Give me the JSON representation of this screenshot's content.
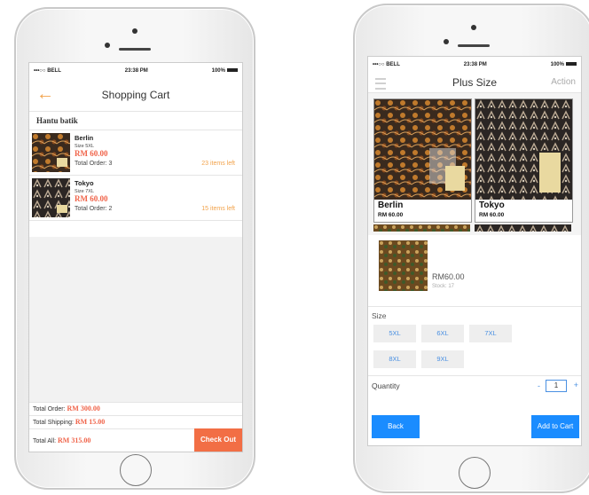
{
  "colors": {
    "accent_orange": "#f2a24a",
    "price_red": "#f0644a",
    "checkout_bg": "#f26e45",
    "primary_blue": "#1a8cff",
    "link_blue": "#4a90e2"
  },
  "status_bar": {
    "carrier": "•••○○ BELL",
    "time": "23:38 PM",
    "battery": "100%"
  },
  "cart_screen": {
    "title": "Shopping Cart",
    "back_icon": "arrow-left-icon",
    "shop_name": "Hantu batik",
    "items": [
      {
        "name": "Berlin",
        "size": "Size 5XL",
        "price": "RM 60.00",
        "total_order": "Total Order: 3",
        "items_left": "23 items left"
      },
      {
        "name": "Tokyo",
        "size": "Size 7XL",
        "price": "RM 60.00",
        "total_order": "Total Order: 2",
        "items_left": "15 items left"
      }
    ],
    "summary": {
      "total_order_label": "Total Order: ",
      "total_order_value": "RM 300.00",
      "total_shipping_label": "Total Shipping: ",
      "total_shipping_value": "RM 15.00",
      "total_all_label": "Total All: ",
      "total_all_value": "RM 315.00"
    },
    "checkout_label": "Check Out"
  },
  "product_screen": {
    "title": "Plus Size",
    "action_label": "Action",
    "menu_icon": "hamburger-menu-icon",
    "products": [
      {
        "name": "Berlin",
        "price": "RM 60.00"
      },
      {
        "name": "Tokyo",
        "price": "RM 60.00"
      }
    ],
    "detail": {
      "price": "RM60.00",
      "stock": "Stock: 17"
    },
    "size_label": "Size",
    "sizes": [
      "5XL",
      "6XL",
      "7XL",
      "8XL",
      "9XL"
    ],
    "quantity_label": "Quantity",
    "quantity_minus": "-",
    "quantity_value": "1",
    "quantity_plus": "+",
    "back_label": "Back",
    "add_to_cart_label": "Add to Cart"
  }
}
